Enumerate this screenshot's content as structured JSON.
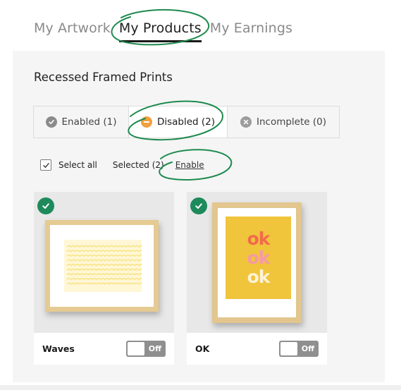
{
  "top_tabs": [
    {
      "label": "My Artwork",
      "active": false
    },
    {
      "label": "My Products",
      "active": true
    },
    {
      "label": "My Earnings",
      "active": false
    }
  ],
  "section": {
    "title": "Recessed Framed Prints"
  },
  "state_tabs": [
    {
      "label": "Enabled (1)",
      "icon": "check-circle-icon"
    },
    {
      "label": "Disabled (2)",
      "icon": "minus-circle-icon",
      "active": true
    },
    {
      "label": "Incomplete (0)",
      "icon": "x-circle-icon"
    }
  ],
  "selection": {
    "select_all_label": "Select all",
    "select_all_checked": true,
    "selected_label": "Selected (2)",
    "enable_link": "Enable"
  },
  "products": [
    {
      "name": "Waves",
      "toggle_label": "Off",
      "selected": true
    },
    {
      "name": "OK",
      "toggle_label": "Off",
      "selected": true
    }
  ],
  "artwork": {
    "ok_text": [
      "ok",
      "ok",
      "ok"
    ]
  },
  "colors": {
    "accent_green": "#1e8a5c",
    "disabled_orange": "#f0a040",
    "panel_bg": "#f5f5f5",
    "ok_art_bg": "#f0c43b",
    "ok_colors": [
      "#f26a4b",
      "#f59aa6",
      "#fff3d6"
    ],
    "wave_color": "#f8e486"
  }
}
